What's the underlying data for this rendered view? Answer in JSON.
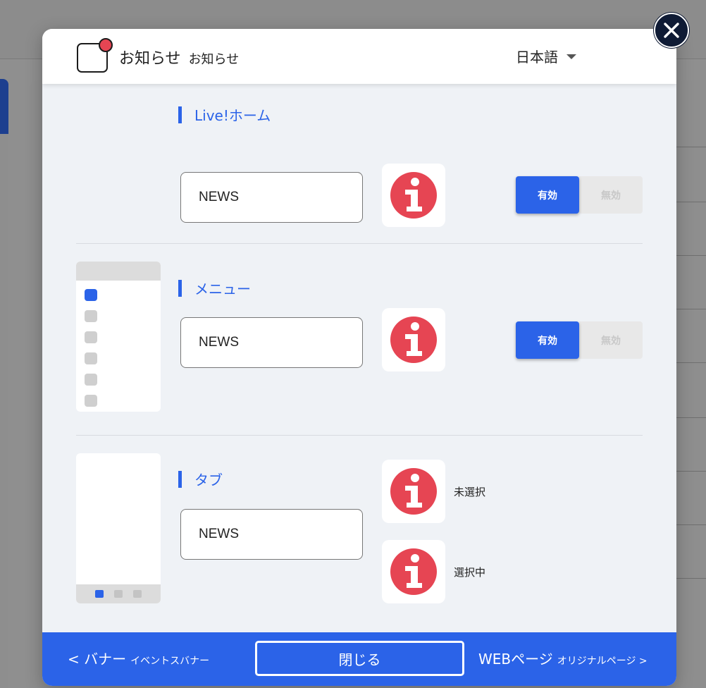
{
  "header": {
    "title": "お知らせ",
    "subtitle": "お知らせ",
    "language": "日本語"
  },
  "sections": {
    "live_home": {
      "label": "Live!ホーム",
      "field_value": "NEWS",
      "toggle_on": "有効",
      "toggle_off": "無効"
    },
    "menu": {
      "label": "メニュー",
      "field_value": "NEWS",
      "toggle_on": "有効",
      "toggle_off": "無効"
    },
    "tab": {
      "label": "タブ",
      "field_value": "NEWS",
      "unselected_label": "未選択",
      "selected_label": "選択中"
    }
  },
  "footer": {
    "prev_label": "< バナー",
    "prev_sub": "イベントスバナー",
    "close_label": "閉じる",
    "next_label": "WEBページ",
    "next_sub": "オリジナルページ >"
  },
  "icons": {
    "info": "info-icon",
    "close": "close-icon",
    "notification": "notification-icon",
    "dropdown": "caret-down-icon"
  },
  "colors": {
    "accent": "#2b63e8",
    "info_red": "#e64553",
    "close_navy": "#0f1b35",
    "panel_bg": "#eff2f6"
  }
}
